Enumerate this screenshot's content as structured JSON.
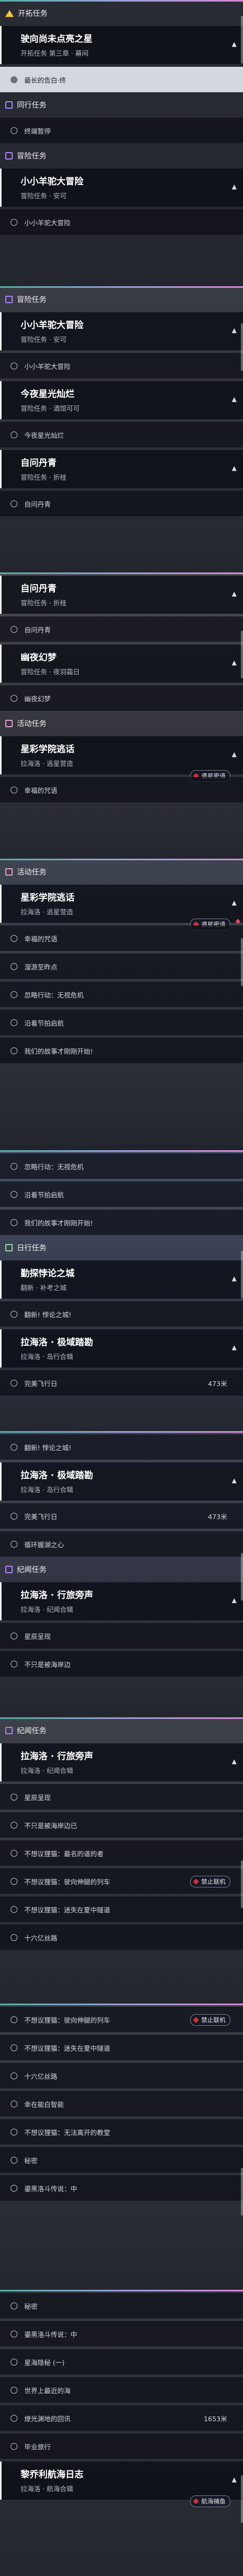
{
  "colors": {
    "trailblaze": "#f4c542",
    "companion": "#9a8cff",
    "adventure": "#b080ff",
    "daily": "#9ad4a0",
    "event": "#e0a0d0",
    "row_bg": "#0a0c14",
    "selected_bg": "#e1e4ec"
  },
  "shots": [
    {
      "rows": [
        {
          "type": "category",
          "icon": "trailblaze-icon",
          "label": "开拓任务"
        },
        {
          "type": "card",
          "title": "驶向尚未点亮之星",
          "subtitle": "开拓任务 第三章 · 幕间"
        },
        {
          "type": "sub",
          "text": "最长的告白·终",
          "selected": true
        },
        {
          "type": "category",
          "icon": "companion-icon",
          "label": "同行任务"
        },
        {
          "type": "sub",
          "text": "终端暂停"
        },
        {
          "type": "category",
          "icon": "adventure-icon",
          "label": "冒险任务"
        },
        {
          "type": "card",
          "title": "小小羊驼大冒险",
          "subtitle": "冒险任务 · 安可"
        },
        {
          "type": "sub",
          "text": "小小羊驼大冒险"
        }
      ]
    },
    {
      "rows": [
        {
          "type": "category",
          "icon": "adventure-icon",
          "label": "冒险任务"
        },
        {
          "type": "card",
          "title": "小小羊驼大冒险",
          "subtitle": "冒险任务 · 安可"
        },
        {
          "type": "sub",
          "text": "小小羊驼大冒险"
        },
        {
          "type": "card",
          "title": "今夜星光灿烂",
          "subtitle": "冒险任务 · 酒馆可可"
        },
        {
          "type": "sub",
          "text": "今夜星光灿烂"
        },
        {
          "type": "card",
          "title": "自问丹青",
          "subtitle": "冒险任务 · 折桂"
        },
        {
          "type": "sub",
          "text": "自问丹青"
        }
      ]
    },
    {
      "rows": [
        {
          "type": "card",
          "title": "自问丹青",
          "subtitle": "冒险任务 · 折桂"
        },
        {
          "type": "sub",
          "text": "自问丹青"
        },
        {
          "type": "card",
          "title": "幽夜幻梦",
          "subtitle": "冒险任务 · 夜羽霜日"
        },
        {
          "type": "sub",
          "text": "幽夜幻梦"
        },
        {
          "type": "category",
          "icon": "event-icon",
          "label": "活动任务"
        },
        {
          "type": "card",
          "title": "星彩学院逃话",
          "subtitle": "拉海洛 · 逃星营造",
          "badge": "遗星密语"
        },
        {
          "type": "sub",
          "text": "幸福的咒语"
        }
      ]
    },
    {
      "rows": [
        {
          "type": "category",
          "icon": "event-icon",
          "label": "活动任务"
        },
        {
          "type": "card",
          "title": "星彩学院逃话",
          "subtitle": "拉海洛 · 逃星营造",
          "badge": "遗星密语",
          "pin": true
        },
        {
          "type": "sub",
          "text": "幸福的咒语"
        },
        {
          "type": "sub",
          "text": "溜游至昨点"
        },
        {
          "type": "sub",
          "text": "忽略行动：无视危机"
        },
        {
          "type": "sub",
          "text": "沿着节拍启航"
        },
        {
          "type": "sub",
          "text": "我们的故事才刚刚开始!"
        }
      ]
    },
    {
      "rows": [
        {
          "type": "sub",
          "text": "忽略行动：无视危机"
        },
        {
          "type": "sub",
          "text": "沿着节拍启航"
        },
        {
          "type": "sub",
          "text": "我们的故事才刚刚开始!"
        },
        {
          "type": "category",
          "icon": "daily-icon",
          "label": "日行任务"
        },
        {
          "type": "card",
          "title": "勤探悖论之城",
          "subtitle": "翻新 · 补考之城"
        },
        {
          "type": "sub",
          "text": "翻新! 悖论之城!"
        },
        {
          "type": "card",
          "title": "拉海洛 · 极域踏勘",
          "subtitle": "拉海洛 · 岛行合辑"
        },
        {
          "type": "sub",
          "text": "完美飞行日",
          "dist": "473米"
        }
      ]
    },
    {
      "rows": [
        {
          "type": "sub",
          "text": "翻新! 悖论之城!"
        },
        {
          "type": "card",
          "title": "拉海洛 · 极域踏勘",
          "subtitle": "拉海洛 · 岛行合辑"
        },
        {
          "type": "sub",
          "text": "完美飞行日",
          "dist": "473米"
        },
        {
          "type": "sub",
          "text": "循环握湖之心"
        },
        {
          "type": "category",
          "icon": "wander-icon",
          "label": "纪闻任务"
        },
        {
          "type": "card",
          "title": "拉海洛 · 行旅旁声",
          "subtitle": "拉海洛 · 纪闻合辑"
        },
        {
          "type": "sub",
          "text": "星辰呈现"
        },
        {
          "type": "sub",
          "text": "不只是被海岸边"
        }
      ]
    },
    {
      "rows": [
        {
          "type": "category",
          "icon": "wander-icon",
          "label": "纪闻任务"
        },
        {
          "type": "card",
          "title": "拉海洛 · 行旅旁声",
          "subtitle": "拉海洛 · 纪闻合辑"
        },
        {
          "type": "sub",
          "text": "星辰呈现"
        },
        {
          "type": "sub",
          "text": "不只是被海岸边已"
        },
        {
          "type": "sub",
          "text": "不想议狸猫：最名的道的者"
        },
        {
          "type": "sub",
          "text": "不想议狸猫：驶向伸腿的列车",
          "badge": "禁止联机"
        },
        {
          "type": "sub",
          "text": "不想议狸猫：迷失在夏中隧道"
        },
        {
          "type": "sub",
          "text": "十六亿丝路"
        }
      ]
    },
    {
      "rows": [
        {
          "type": "sub",
          "text": "不想议狸猫：驶向伸腿的列车",
          "badge": "禁止联机"
        },
        {
          "type": "sub",
          "text": "不想议狸猫：迷失在夏中隧道"
        },
        {
          "type": "sub",
          "text": "十六亿丝路"
        },
        {
          "type": "sub",
          "text": "幸在能白智能"
        },
        {
          "type": "sub",
          "text": "不想议狸猫：无法离开的教堂"
        },
        {
          "type": "sub",
          "text": "秘密"
        },
        {
          "type": "sub",
          "text": "鎏黑洛斗传说：中"
        }
      ]
    },
    {
      "rows": [
        {
          "type": "sub",
          "text": "秘密"
        },
        {
          "type": "sub",
          "text": "鎏黑洛斗传说：中"
        },
        {
          "type": "sub",
          "text": "星海隐秘 (一)"
        },
        {
          "type": "sub",
          "text": "世界上最近的海"
        },
        {
          "type": "sub",
          "text": "燎光渊地的回讯",
          "dist": "1653米"
        },
        {
          "type": "sub",
          "text": "毕业旅行"
        },
        {
          "type": "card",
          "title": "黎乔利航海日志",
          "subtitle": "拉海洛 · 航海合辑",
          "badge": "航海捕鱼"
        }
      ]
    }
  ]
}
